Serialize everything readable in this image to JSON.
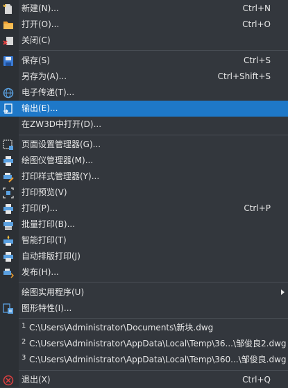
{
  "menu": {
    "new": {
      "label": "新建(N)...",
      "shortcut": "Ctrl+N"
    },
    "open": {
      "label": "打开(O)...",
      "shortcut": "Ctrl+O"
    },
    "close": {
      "label": "关闭(C)"
    },
    "save": {
      "label": "保存(S)",
      "shortcut": "Ctrl+S"
    },
    "save_as": {
      "label": "另存为(A)...",
      "shortcut": "Ctrl+Shift+S"
    },
    "etransmit": {
      "label": "电子传递(T)..."
    },
    "export": {
      "label": "输出(E)..."
    },
    "open_zw3d": {
      "label": "在ZW3D中打开(D)..."
    },
    "page_setup": {
      "label": "页面设置管理器(G)..."
    },
    "plotter": {
      "label": "绘图仪管理器(M)..."
    },
    "plot_style": {
      "label": "打印样式管理器(Y)..."
    },
    "preview": {
      "label": "打印预览(V)"
    },
    "print": {
      "label": "打印(P)...",
      "shortcut": "Ctrl+P"
    },
    "batch": {
      "label": "批量打印(B)..."
    },
    "smart": {
      "label": "智能打印(T)"
    },
    "auto_layout": {
      "label": "自动排版打印(J)"
    },
    "publish": {
      "label": "发布(H)..."
    },
    "utilities": {
      "label": "绘图实用程序(U)"
    },
    "properties": {
      "label": "图形特性(I)..."
    },
    "exit": {
      "label": "退出(X)",
      "shortcut": "Ctrl+Q"
    }
  },
  "recent": [
    {
      "num": "1",
      "path": "C:\\Users\\Administrator\\Documents\\新块.dwg"
    },
    {
      "num": "2",
      "path": "C:\\Users\\Administrator\\AppData\\Local\\Temp\\36...\\邹俊良2.dwg"
    },
    {
      "num": "3",
      "path": "C:\\Users\\Administrator\\AppData\\Local\\Temp\\360...\\邹俊良.dwg"
    }
  ],
  "colors": {
    "background": "#33373d",
    "highlight": "#1e78c8",
    "icon_blue": "#5aa0e0",
    "icon_orange": "#f0a030",
    "exit_red": "#e04040"
  }
}
